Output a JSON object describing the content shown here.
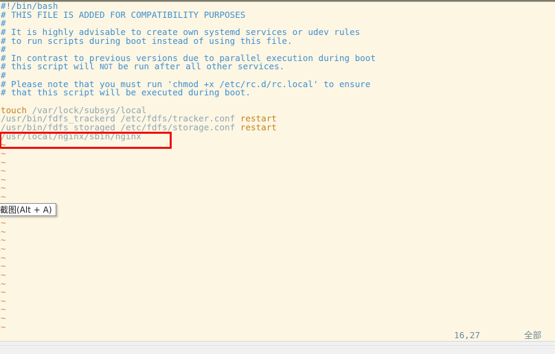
{
  "window": {
    "app": "vim",
    "bg_color": "#fdf6e3",
    "comment_color": "#3f8fd0",
    "command_color": "#c4831f",
    "path_color": "#8fa6b3",
    "tilde_color": "#d0894a",
    "annotation_color": "#ee1111"
  },
  "editor": {
    "lines": [
      {
        "type": "comment",
        "text": "#!/bin/bash"
      },
      {
        "type": "comment",
        "text": "# THIS FILE IS ADDED FOR COMPATIBILITY PURPOSES"
      },
      {
        "type": "comment",
        "text": "#"
      },
      {
        "type": "comment",
        "text": "# It is highly advisable to create own systemd services or udev rules"
      },
      {
        "type": "comment",
        "text": "# to run scripts during boot instead of using this file."
      },
      {
        "type": "comment",
        "text": "#"
      },
      {
        "type": "comment",
        "text": "# In contrast to previous versions due to parallel execution during boot"
      },
      {
        "type": "comment_todo",
        "pre": "# this script will ",
        "todo": "NOT",
        "post": " be run after all other services."
      },
      {
        "type": "comment",
        "text": "#"
      },
      {
        "type": "comment",
        "text": "# Please note that you must run 'chmod +x /etc/rc.d/rc.local' to ensure"
      },
      {
        "type": "comment",
        "text": "# that this script will be executed during boot."
      },
      {
        "type": "blank",
        "text": ""
      },
      {
        "type": "command",
        "cmd": "touch",
        "args": " /var/lock/subsys/local"
      },
      {
        "type": "command",
        "cmd": "",
        "args": "/usr/bin/fdfs_trackerd /etc/fdfs/tracker.conf ",
        "tail": "restart"
      },
      {
        "type": "command",
        "cmd": "",
        "args": "/usr/bin/fdfs_storaged /etc/fdfs/storage.conf ",
        "tail": "restart"
      },
      {
        "type": "command",
        "cmd": "",
        "args": "/usr/local/nginx/sbin/nginx",
        "tail": ""
      }
    ],
    "tilde": "~",
    "tilde_line_count": 23
  },
  "annotation": {
    "name": "red-highlight-box",
    "targets_line": "/usr/local/nginx/sbin/nginx",
    "color": "#ee1111"
  },
  "tooltip": {
    "label": "截图(Alt + A)",
    "shortcut": "Alt + A"
  },
  "statusbar": {
    "cursor_position": "16,27",
    "scroll_indicator": "全部"
  }
}
